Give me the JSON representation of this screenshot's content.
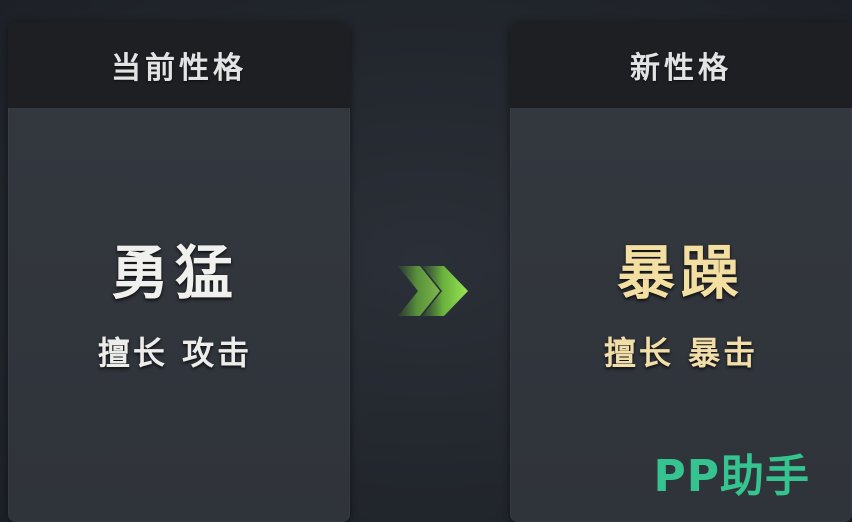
{
  "current": {
    "header": "当前性格",
    "trait": "勇猛",
    "desc": "擅长 攻击"
  },
  "next": {
    "header": "新性格",
    "trait": "暴躁",
    "desc": "擅长 暴击"
  },
  "arrow_icon": "double-chevron-right-icon",
  "watermark": "PP助手",
  "colors": {
    "current_text": "#f0f0ee",
    "new_text": "#f4dfa2",
    "arrow": "#8fe04a",
    "watermark": "#35c48f"
  }
}
